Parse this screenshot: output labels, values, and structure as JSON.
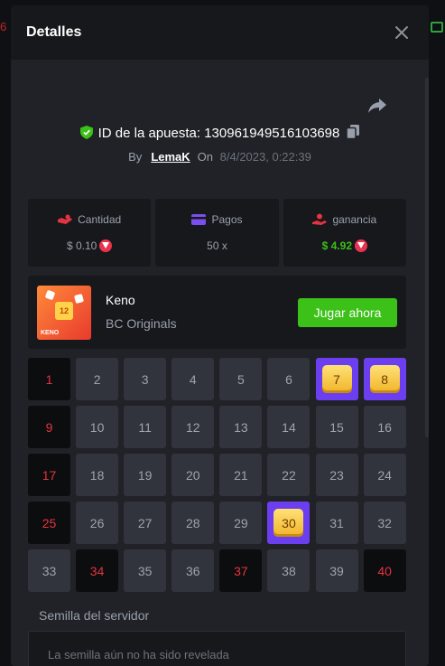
{
  "background": {
    "left_fragment": "6"
  },
  "modal": {
    "title": "Detalles"
  },
  "bet": {
    "id_label": "ID de la apuesta:",
    "id_value": "130961949516103698",
    "by_label": "By",
    "user": "LemaK",
    "on_label": "On",
    "date": "8/4/2023, 0:22:39"
  },
  "stats": {
    "amount": {
      "label": "Cantidad",
      "value": "$ 0.10"
    },
    "payout": {
      "label": "Pagos",
      "value": "50 x"
    },
    "profit": {
      "label": "ganancia",
      "value": "$ 4.92"
    }
  },
  "game": {
    "thumb_number": "12",
    "thumb_label": "KENO",
    "name": "Keno",
    "provider": "BC Originals",
    "play_label": "Jugar ahora"
  },
  "grid": {
    "cells": [
      {
        "n": "1",
        "s": "picked"
      },
      {
        "n": "2",
        "s": "normal"
      },
      {
        "n": "3",
        "s": "normal"
      },
      {
        "n": "4",
        "s": "normal"
      },
      {
        "n": "5",
        "s": "normal"
      },
      {
        "n": "6",
        "s": "normal"
      },
      {
        "n": "7",
        "s": "hit"
      },
      {
        "n": "8",
        "s": "hit"
      },
      {
        "n": "9",
        "s": "picked"
      },
      {
        "n": "10",
        "s": "normal"
      },
      {
        "n": "11",
        "s": "normal"
      },
      {
        "n": "12",
        "s": "normal"
      },
      {
        "n": "13",
        "s": "normal"
      },
      {
        "n": "14",
        "s": "normal"
      },
      {
        "n": "15",
        "s": "normal"
      },
      {
        "n": "16",
        "s": "normal"
      },
      {
        "n": "17",
        "s": "picked"
      },
      {
        "n": "18",
        "s": "normal"
      },
      {
        "n": "19",
        "s": "normal"
      },
      {
        "n": "20",
        "s": "normal"
      },
      {
        "n": "21",
        "s": "normal"
      },
      {
        "n": "22",
        "s": "normal"
      },
      {
        "n": "23",
        "s": "normal"
      },
      {
        "n": "24",
        "s": "normal"
      },
      {
        "n": "25",
        "s": "picked"
      },
      {
        "n": "26",
        "s": "normal"
      },
      {
        "n": "27",
        "s": "normal"
      },
      {
        "n": "28",
        "s": "normal"
      },
      {
        "n": "29",
        "s": "normal"
      },
      {
        "n": "30",
        "s": "hit"
      },
      {
        "n": "31",
        "s": "normal"
      },
      {
        "n": "32",
        "s": "normal"
      },
      {
        "n": "33",
        "s": "normal"
      },
      {
        "n": "34",
        "s": "picked"
      },
      {
        "n": "35",
        "s": "normal"
      },
      {
        "n": "36",
        "s": "normal"
      },
      {
        "n": "37",
        "s": "picked"
      },
      {
        "n": "38",
        "s": "normal"
      },
      {
        "n": "39",
        "s": "normal"
      },
      {
        "n": "40",
        "s": "picked"
      }
    ]
  },
  "seed": {
    "label": "Semilla del servidor",
    "text": "La semilla aún no ha sido revelada"
  },
  "colors": {
    "accent_green": "#3bc117",
    "hit_purple": "#6b3ef0",
    "picked_red": "#e5333f"
  }
}
